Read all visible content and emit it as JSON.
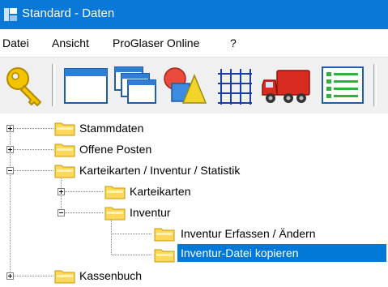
{
  "window": {
    "title": "Standard - Daten"
  },
  "menu": {
    "items": [
      {
        "label": "Datei"
      },
      {
        "label": "Ansicht"
      },
      {
        "label": "ProGlaser Online"
      },
      {
        "label": "?"
      }
    ]
  },
  "toolbar": {
    "buttons": [
      {
        "icon": "key-icon"
      },
      {
        "icon": "window-icon"
      },
      {
        "icon": "cascade-windows-icon"
      },
      {
        "icon": "shapes-icon"
      },
      {
        "icon": "grid-icon"
      },
      {
        "icon": "truck-icon"
      },
      {
        "icon": "list-icon"
      }
    ]
  },
  "tree": {
    "nodes": [
      {
        "label": "Stammdaten",
        "expander": "+"
      },
      {
        "label": "Offene Posten",
        "expander": "+"
      },
      {
        "label": "Karteikarten / Inventur / Statistik",
        "expander": "-"
      },
      {
        "label": "Karteikarten",
        "expander": "+"
      },
      {
        "label": "Inventur",
        "expander": "-"
      },
      {
        "label": "Inventur Erfassen / Ändern"
      },
      {
        "label": "Inventur-Datei kopieren",
        "selected": true
      },
      {
        "label": "Kassenbuch",
        "expander": "+"
      }
    ]
  },
  "colors": {
    "titlebar": "#0a78d7",
    "selection": "#0078d7",
    "folder": "#ffd75a"
  }
}
